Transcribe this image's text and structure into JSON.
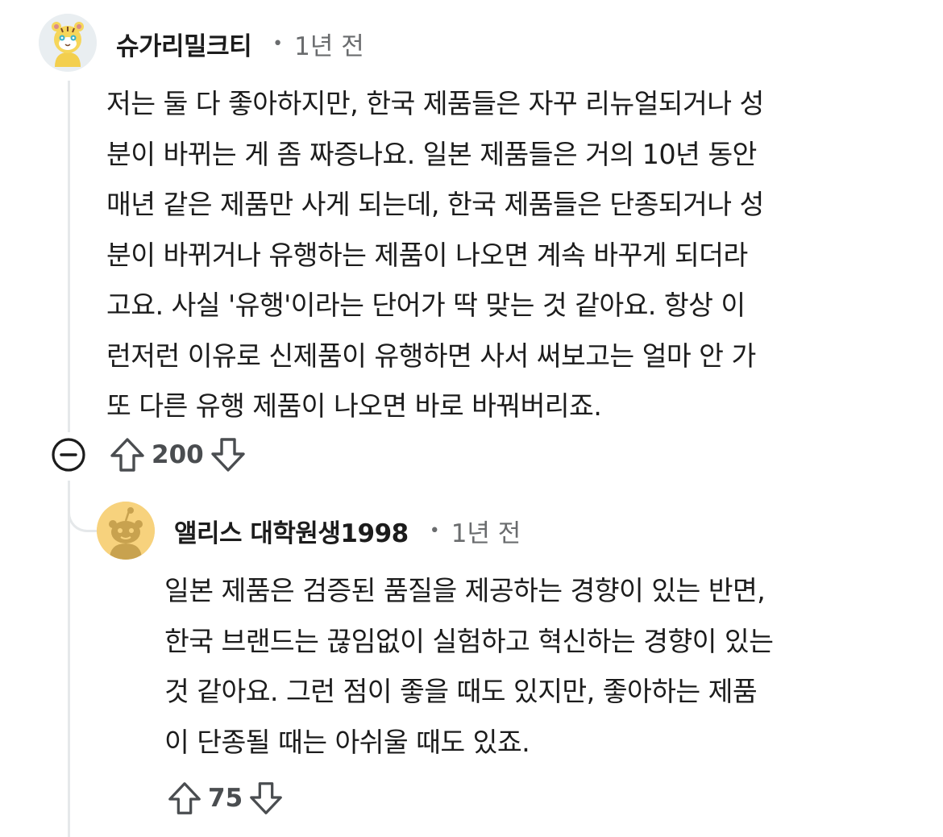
{
  "comment": {
    "author": "슈가리밀크티",
    "separator": "•",
    "timestamp": "1년 전",
    "body_lines": [
      "저는 둘 다 좋아하지만, 한국 제품들은 자꾸 리뉴얼되거나 성",
      "분이 바뀌는 게 좀 짜증나요. 일본 제품들은 거의 10년 동안",
      "매년 같은 제품만 사게 되는데, 한국 제품들은 단종되거나 성",
      "분이 바뀌거나 유행하는 제품이 나오면 계속 바꾸게 되더라",
      "고요. 사실 '유행'이라는 단어가 딱 맞는 것 같아요. 항상 이",
      "런저런 이유로 신제품이 유행하면 사서 써보고는 얼마 안 가",
      "또 다른 유행 제품이 나오면 바로 바꿔버리죠."
    ],
    "votes": "200",
    "icons": {
      "collapse": "collapse-minus-icon",
      "upvote": "upvote-arrow-icon",
      "downvote": "downvote-arrow-icon"
    }
  },
  "reply": {
    "author": "앨리스 대학원생1998",
    "separator": "•",
    "timestamp": "1년 전",
    "body_lines": [
      "일본 제품은 검증된 품질을 제공하는 경향이 있는 반면,",
      "한국 브랜드는 끊임없이 실험하고 혁신하는 경향이 있는",
      "것 같아요. 그런 점이 좋을 때도 있지만, 좋아하는 제품",
      "이 단종될 때는 아쉬울 때도 있죠."
    ],
    "votes": "75",
    "icons": {
      "upvote": "upvote-arrow-icon",
      "downvote": "downvote-arrow-icon"
    }
  },
  "colors": {
    "text": "#1c1c1c",
    "muted": "#6a6c6e",
    "thread_line": "#e5e8ea",
    "reply_avatar_bg": "#f7d27d"
  }
}
